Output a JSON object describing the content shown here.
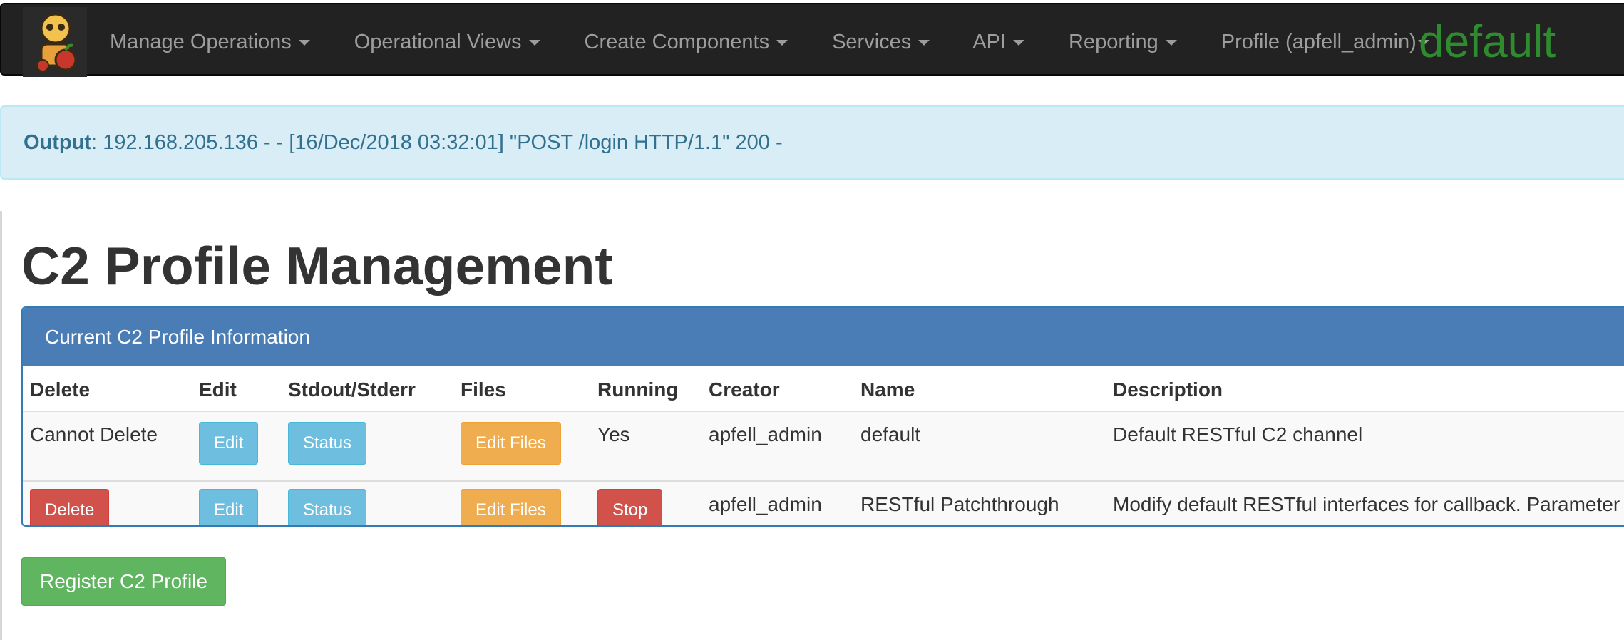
{
  "navbar": {
    "logo_alt": "apfell",
    "items": [
      {
        "label": "Manage Operations"
      },
      {
        "label": "Operational Views"
      },
      {
        "label": "Create Components"
      },
      {
        "label": "Services"
      },
      {
        "label": "API"
      },
      {
        "label": "Reporting"
      },
      {
        "label": "Profile (apfell_admin)"
      }
    ],
    "operation": "default"
  },
  "alert": {
    "label": "Output",
    "message": ": 192.168.205.136 - - [16/Dec/2018 03:32:01] \"POST /login HTTP/1.1\" 200 -"
  },
  "page": {
    "title": "C2 Profile Management"
  },
  "panel": {
    "heading": "Current C2 Profile Information",
    "columns": [
      "Delete",
      "Edit",
      "Stdout/Stderr",
      "Files",
      "Running",
      "Creator",
      "Name",
      "Description"
    ],
    "rows": [
      {
        "delete": "Cannot Delete",
        "edit": "Edit",
        "status": "Status",
        "files": "Edit Files",
        "running": "Yes",
        "creator": "apfell_admin",
        "name": "default",
        "description": "Default RESTful C2 channel"
      },
      {
        "delete": "Delete",
        "edit": "Edit",
        "status": "Status",
        "files": "Edit Files",
        "running": "Stop",
        "creator": "apfell_admin",
        "name": "RESTful Patchthrough",
        "description": "Modify default RESTful interfaces for callback. Parameter"
      }
    ]
  },
  "actions": {
    "register": "Register C2 Profile"
  },
  "colors": {
    "navbar_bg": "#222222",
    "brand_green": "#2e8b2e",
    "panel_primary": "#4a7db6",
    "info": "#6ebedf",
    "warning": "#efad4f",
    "danger": "#d1514b",
    "success": "#5fb560"
  }
}
